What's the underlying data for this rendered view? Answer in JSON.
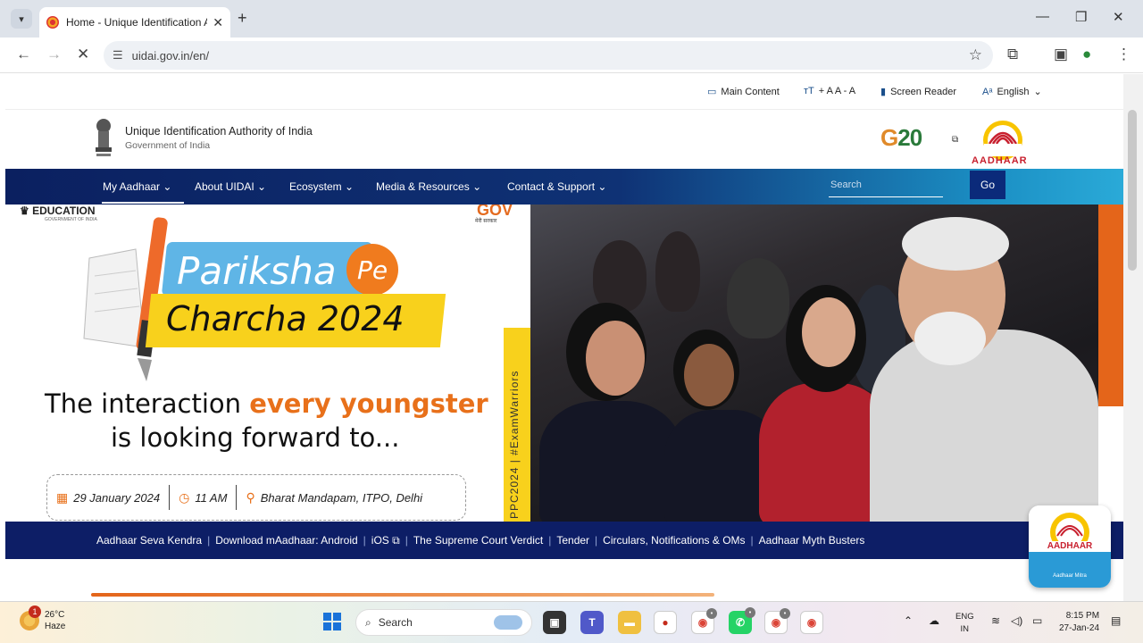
{
  "browser": {
    "tab_title": "Home - Unique Identification A",
    "url": "uidai.gov.in/en/",
    "new_tab_symbol": "+",
    "tab_close_symbol": "✕"
  },
  "utility": {
    "main_content": "Main Content",
    "text_size": "+ A A - A",
    "screen_reader": "Screen Reader",
    "language": "English"
  },
  "header": {
    "org_name": "Unique Identification Authority of India",
    "org_sub": "Government of India",
    "g20_g": "G",
    "g20_20": "20",
    "aadhaar_text": "AADHAAR"
  },
  "nav": {
    "items": [
      "My Aadhaar",
      "About UIDAI",
      "Ecosystem",
      "Media & Resources",
      "Contact & Support"
    ],
    "search_placeholder": "Search",
    "go_label": "Go"
  },
  "hero": {
    "edu_logo": "EDUCATION",
    "edu_sub": "GOVERNMENT OF INDIA",
    "gov_logo": "GOV",
    "gov_sub": "मेरी सरकार",
    "pariksha": "Pariksha",
    "pe": "Pe",
    "charcha": "Charcha 2024",
    "tagline_a": "The interaction ",
    "tagline_highlight": "every youngster",
    "tagline_b": "is looking forward to...",
    "event_date": "29 January 2024",
    "event_time": "11 AM",
    "event_venue": "Bharat Mandapam, ITPO, Delhi",
    "vertical_text": "PPC2024  |  #ExamWarriors"
  },
  "quicklinks": {
    "items": [
      "Aadhaar Seva Kendra",
      "Download mAadhaar: Android",
      "iOS ⧉",
      "The Supreme Court Verdict",
      "Tender",
      "Circulars, Notifications & OMs",
      "Aadhaar Myth Busters"
    ]
  },
  "myth_badge": {
    "label": "AADHAAR",
    "sub": "Aadhaar Mitra"
  },
  "taskbar": {
    "weather_temp": "26°C",
    "weather_desc": "Haze",
    "weather_badge": "1",
    "search_label": "Search",
    "lang_1": "ENG",
    "lang_2": "IN",
    "time": "8:15 PM",
    "date": "27-Jan-24"
  },
  "colors": {
    "nav_dark": "#0b2060",
    "nav_light": "#2aaad8",
    "quicklinks_bg": "#0d1e66",
    "accent_orange": "#e8701a",
    "yellow": "#f8d11c"
  }
}
